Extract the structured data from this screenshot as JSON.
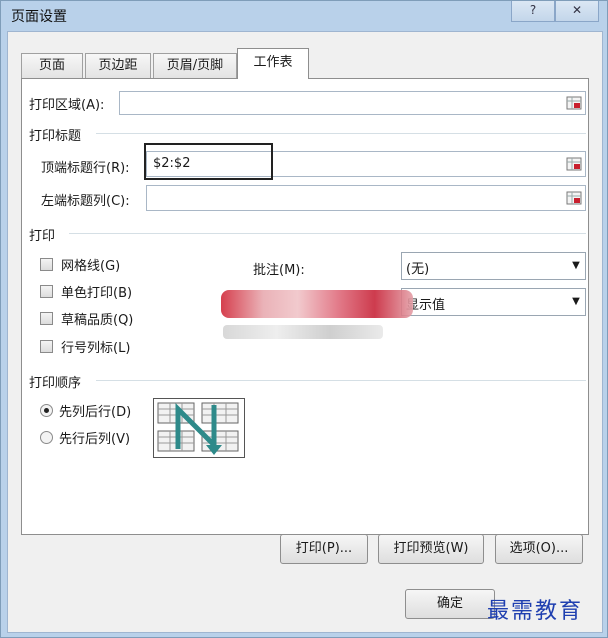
{
  "window": {
    "title": "页面设置",
    "help_label": "?",
    "close_label": "✕"
  },
  "tabs": [
    {
      "label": "页面"
    },
    {
      "label": "页边距"
    },
    {
      "label": "页眉/页脚"
    },
    {
      "label": "工作表"
    }
  ],
  "print_area": {
    "label": "打印区域(A):",
    "value": ""
  },
  "print_titles": {
    "section": "打印标题",
    "top_rows_label": "顶端标题行(R):",
    "top_rows_value": "$2:$2",
    "left_cols_label": "左端标题列(C):",
    "left_cols_value": ""
  },
  "print": {
    "section": "打印",
    "checkboxes": [
      {
        "label": "网格线(G)",
        "checked": false
      },
      {
        "label": "单色打印(B)",
        "checked": false
      },
      {
        "label": "草稿品质(Q)",
        "checked": false
      },
      {
        "label": "行号列标(L)",
        "checked": false
      }
    ],
    "comments_label": "批注(M):",
    "comments_value": "(无)",
    "errors_value": "显示值"
  },
  "page_order": {
    "section": "打印顺序",
    "options": [
      {
        "label": "先列后行(D)",
        "selected": true
      },
      {
        "label": "先行后列(V)",
        "selected": false
      }
    ]
  },
  "buttons": {
    "print": "打印(P)...",
    "preview": "打印预览(W)",
    "options": "选项(O)...",
    "ok": "确定"
  },
  "watermark": "最需教育",
  "colors": {
    "title_bar": "#b9d1ea",
    "accent_arrow": "#2e8a8a"
  }
}
